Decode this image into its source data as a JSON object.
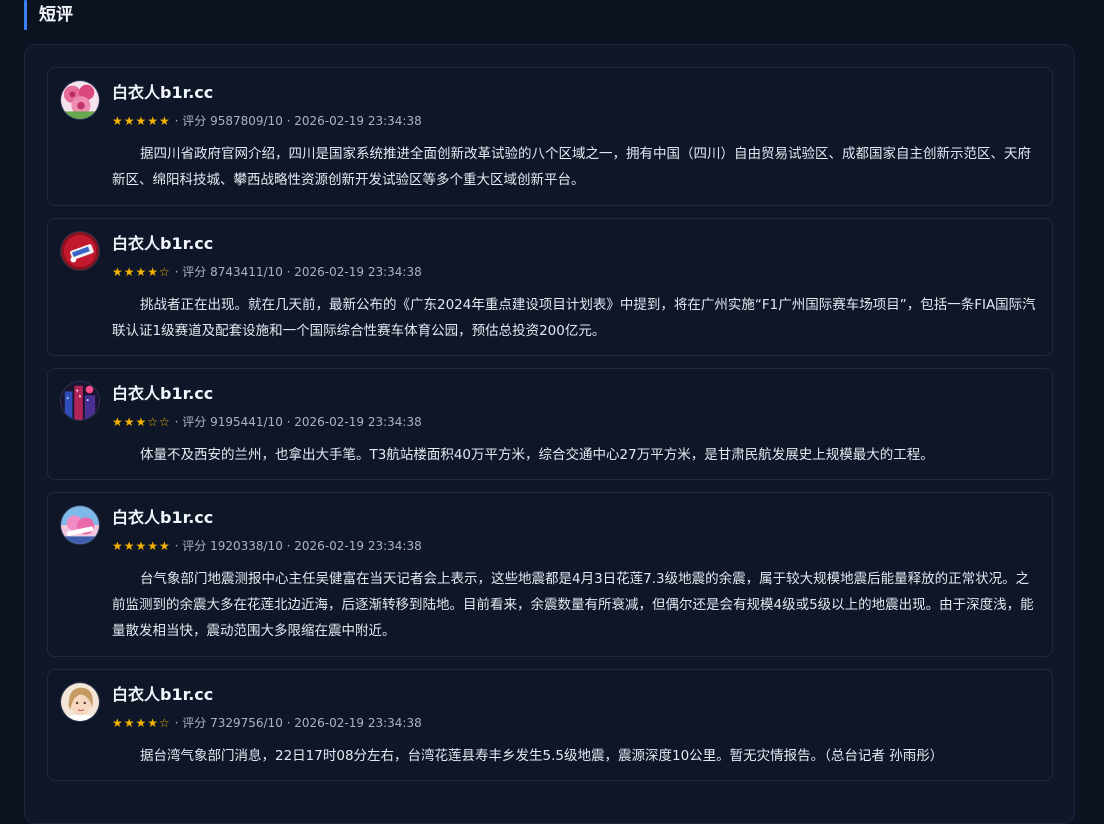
{
  "section": {
    "title": "短评"
  },
  "reviews": [
    {
      "user": "白衣人b1r.cc",
      "stars": "★★★★★",
      "meta": "· 评分 9587809/10 · 2026-02-19 23:34:38",
      "text": "据四川省政府官网介绍，四川是国家系统推进全面创新改革试验的八个区域之一，拥有中国（四川）自由贸易试验区、成都国家自主创新示范区、天府新区、绵阳科技城、攀西战略性资源创新开发试验区等多个重大区域创新平台。"
    },
    {
      "user": "白衣人b1r.cc",
      "stars": "★★★★☆",
      "meta": "· 评分 8743411/10 · 2026-02-19 23:34:38",
      "text": "挑战者正在出现。就在几天前，最新公布的《广东2024年重点建设项目计划表》中提到，将在广州实施“F1广州国际赛车场项目”，包括一条FIA国际汽联认证1级赛道及配套设施和一个国际综合性赛车体育公园，预估总投资200亿元。"
    },
    {
      "user": "白衣人b1r.cc",
      "stars": "★★★☆☆",
      "meta": "· 评分 9195441/10 · 2026-02-19 23:34:38",
      "text": "体量不及西安的兰州，也拿出大手笔。T3航站楼面积40万平方米，综合交通中心27万平方米，是甘肃民航发展史上规模最大的工程。"
    },
    {
      "user": "白衣人b1r.cc",
      "stars": "★★★★★",
      "meta": "· 评分 1920338/10 · 2026-02-19 23:34:38",
      "text": "台气象部门地震测报中心主任吴健富在当天记者会上表示，这些地震都是4月3日花莲7.3级地震的余震，属于较大规模地震后能量释放的正常状况。之前监测到的余震大多在花莲北边近海，后逐渐转移到陆地。目前看来，余震数量有所衰减，但偶尔还是会有规模4级或5级以上的地震出现。由于深度浅，能量散发相当快，震动范围大多限缩在震中附近。"
    },
    {
      "user": "白衣人b1r.cc",
      "stars": "★★★★☆",
      "meta": "· 评分 7329756/10 · 2026-02-19 23:34:38",
      "text": "据台湾气象部门消息，22日17时08分左右，台湾花莲县寿丰乡发生5.5级地震，震源深度10公里。暂无灾情报告。（总台记者 孙雨彤）"
    }
  ],
  "colors": {
    "accent": "#3b82f6",
    "star": "#f5b301",
    "background": "#0b1220",
    "panel": "#0f1729",
    "card": "#0e1627"
  },
  "icons": [
    "avatar-roses",
    "avatar-red-badge",
    "avatar-neon-city",
    "avatar-pink-sky",
    "avatar-portrait"
  ]
}
